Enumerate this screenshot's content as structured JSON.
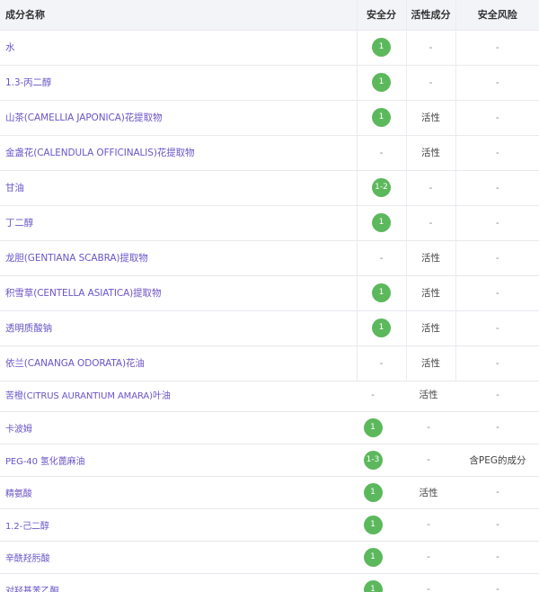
{
  "headers": [
    "成分名称",
    "安全分",
    "活性成分",
    "安全风险"
  ],
  "rows_top": [
    {
      "name": "水",
      "score": "1",
      "active": "-",
      "risk": "-"
    },
    {
      "name": "1.3-丙二醇",
      "score": "1",
      "active": "-",
      "risk": "-"
    },
    {
      "name": "山茶(CAMELLIA JAPONICA)花提取物",
      "score": "1",
      "active": "活性",
      "risk": "-"
    },
    {
      "name": "金盏花(CALENDULA OFFICINALIS)花提取物",
      "score": "-",
      "active": "活性",
      "risk": "-"
    },
    {
      "name": "甘油",
      "score": "1-2",
      "active": "-",
      "risk": "-"
    },
    {
      "name": "丁二醇",
      "score": "1",
      "active": "-",
      "risk": "-"
    },
    {
      "name": "龙胆(GENTIANA SCABRA)提取物",
      "score": "-",
      "active": "活性",
      "risk": "-"
    },
    {
      "name": "积雪草(CENTELLA ASIATICA)提取物",
      "score": "1",
      "active": "活性",
      "risk": "-"
    },
    {
      "name": "透明质酸钠",
      "score": "1",
      "active": "活性",
      "risk": "-"
    },
    {
      "name": "依兰(CANANGA ODORATA)花油",
      "score": "-",
      "active": "活性",
      "risk": "-"
    }
  ],
  "rows_bottom": [
    {
      "name": "苦橙(CITRUS AURANTIUM AMARA)叶油",
      "score": "-",
      "active": "活性",
      "risk": "-"
    },
    {
      "name": "卡波姆",
      "score": "1",
      "active": "-",
      "risk": "-"
    },
    {
      "name": "PEG-40 氢化蓖麻油",
      "score": "1-3",
      "active": "-",
      "risk": "含PEG的成分"
    },
    {
      "name": "精氨酸",
      "score": "1",
      "active": "活性",
      "risk": "-"
    },
    {
      "name": "1.2-己二醇",
      "score": "1",
      "active": "-",
      "risk": "-"
    },
    {
      "name": "辛酰羟肟酸",
      "score": "1",
      "active": "-",
      "risk": "-"
    },
    {
      "name": "对羟基苯乙酮",
      "score": "1",
      "active": "-",
      "risk": "-"
    }
  ],
  "colors": {
    "badge": "#5cb85c",
    "name": "#6a55c8",
    "header_bg": "#f3f4f8"
  }
}
